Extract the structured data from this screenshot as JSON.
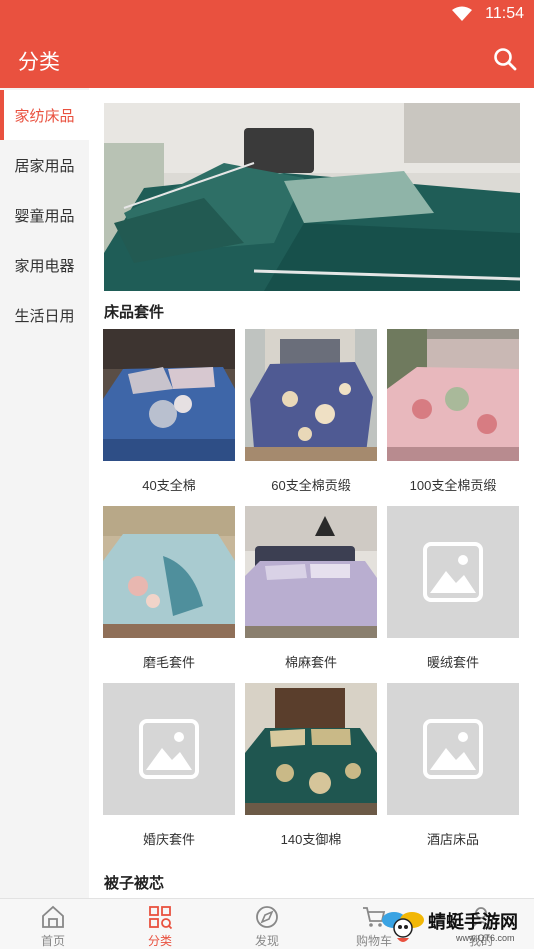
{
  "status_bar": {
    "time": "11:54"
  },
  "app_bar": {
    "title": "分类"
  },
  "sidebar": {
    "items": [
      {
        "label": "家纺床品",
        "active": true
      },
      {
        "label": "居家用品",
        "active": false
      },
      {
        "label": "婴童用品",
        "active": false
      },
      {
        "label": "家用电器",
        "active": false
      },
      {
        "label": "生活日用",
        "active": false
      }
    ]
  },
  "sections": [
    {
      "title": "床品套件",
      "items": [
        {
          "label": "40支全棉",
          "image": "bedding-photo"
        },
        {
          "label": "60支全棉贡缎",
          "image": "bedding-photo"
        },
        {
          "label": "100支全棉贡缎",
          "image": "bedding-photo"
        },
        {
          "label": "磨毛套件",
          "image": "bedding-photo"
        },
        {
          "label": "棉麻套件",
          "image": "bedding-photo"
        },
        {
          "label": "暖绒套件",
          "image": "placeholder"
        },
        {
          "label": "婚庆套件",
          "image": "placeholder"
        },
        {
          "label": "140支御棉",
          "image": "bedding-photo"
        },
        {
          "label": "酒店床品",
          "image": "placeholder"
        }
      ]
    },
    {
      "title": "被子被芯",
      "items": []
    }
  ],
  "bottom_nav": {
    "items": [
      {
        "label": "首页",
        "icon": "home-icon",
        "active": false
      },
      {
        "label": "分类",
        "icon": "category-grid-icon",
        "active": true
      },
      {
        "label": "发现",
        "icon": "discover-icon",
        "active": false
      },
      {
        "label": "购物车",
        "icon": "cart-icon",
        "active": false
      },
      {
        "label": "我的",
        "icon": "profile-icon",
        "active": false
      }
    ]
  },
  "watermark": {
    "name": "蜻蜓手游网",
    "url": "www.QT6.com"
  },
  "colors": {
    "brand": "#e9513f",
    "sidebar_bg": "#f4f4f4",
    "placeholder": "#d6d6d6"
  }
}
